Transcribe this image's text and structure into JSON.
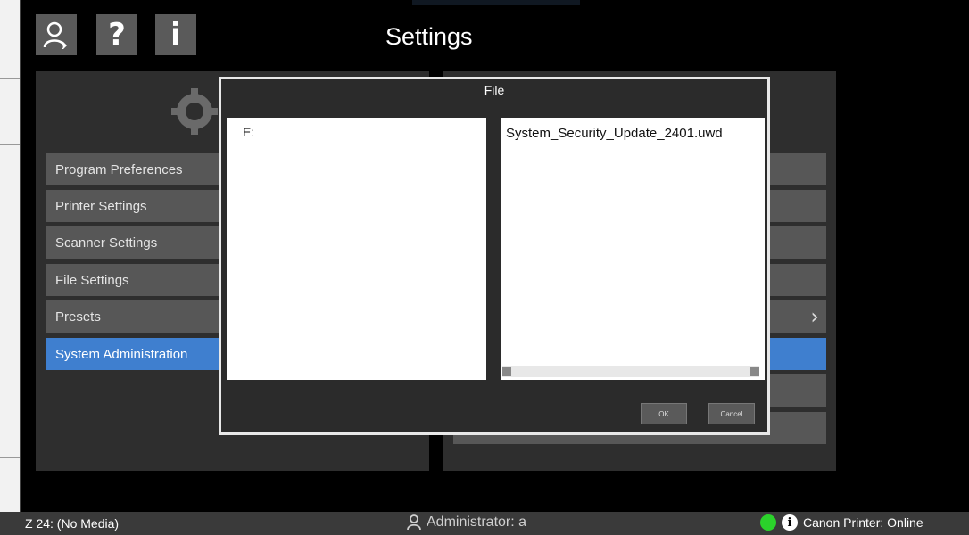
{
  "window": {
    "title": "Settings"
  },
  "toolbar": {
    "buttons": [
      {
        "icon": "user-icon"
      },
      {
        "icon": "help-icon",
        "glyph": "?"
      },
      {
        "icon": "info-icon",
        "glyph": "i"
      }
    ]
  },
  "sidebar": {
    "items": [
      {
        "label": "Program Preferences",
        "active": false
      },
      {
        "label": "Printer Settings",
        "active": false
      },
      {
        "label": "Scanner Settings",
        "active": false
      },
      {
        "label": "File Settings",
        "active": false
      },
      {
        "label": "Presets",
        "active": false
      },
      {
        "label": "System Administration",
        "active": true
      }
    ]
  },
  "right_panel": {
    "chevron": "›"
  },
  "dialog": {
    "title": "File",
    "drives": [
      "E:"
    ],
    "files": [
      "System_Security_Update_2401.uwd"
    ],
    "ok_label": "OK",
    "cancel_label": "Cancel"
  },
  "status_bar": {
    "media": "Z 24: (No Media)",
    "user": "Administrator: a",
    "printer": "Canon Printer: Online",
    "printer_status_color": "#2bd22b"
  },
  "colors": {
    "accent": "#3f7fcf",
    "panel": "#2e2e2e",
    "menu_item": "#575757"
  }
}
